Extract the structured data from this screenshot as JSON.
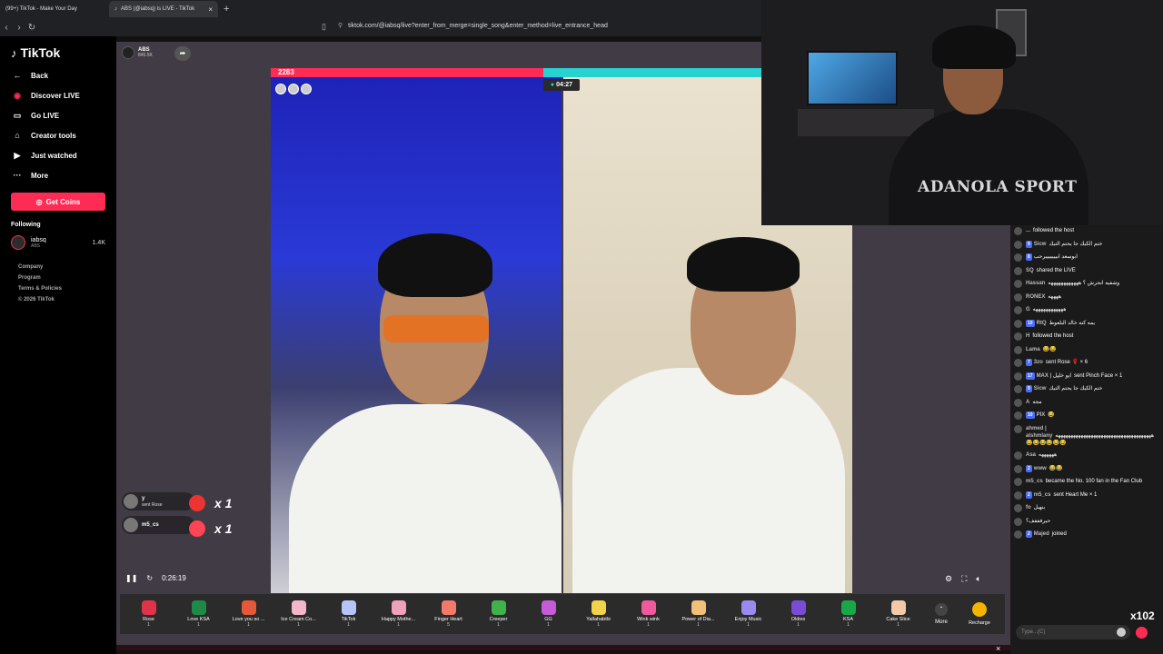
{
  "browser": {
    "tabs": [
      {
        "title": "(99+) TikTok - Make Your Day"
      },
      {
        "title": "ABS (@iabsq) is LIVE - TikTok"
      }
    ],
    "url": "tiktok.com/@iabsq/live?enter_from_merge=single_song&enter_method=live_entrance_head"
  },
  "sidebar": {
    "logo": "TikTok",
    "nav": [
      {
        "label": "Back",
        "icon": "back-arrow-icon"
      },
      {
        "label": "Discover LIVE",
        "icon": "live-icon"
      },
      {
        "label": "Go LIVE",
        "icon": "camera-icon"
      },
      {
        "label": "Creator tools",
        "icon": "home-icon"
      },
      {
        "label": "Just watched",
        "icon": "play-icon"
      },
      {
        "label": "More",
        "icon": "more-icon"
      }
    ],
    "get_coins": "Get Coins",
    "following_label": "Following",
    "following": [
      {
        "name": "iabsq",
        "sub": "ABS",
        "count": "1.4K"
      }
    ],
    "footer": [
      "Company",
      "Program",
      "Terms & Policies",
      "© 2026 TikTok"
    ]
  },
  "stream": {
    "host_name": "ABS",
    "host_likes": "845.5K",
    "pk_score": "2283",
    "timer": "04:27",
    "elapsed": "0:26:19"
  },
  "gift_feed": [
    {
      "name": "y",
      "action": "sent Rose",
      "count": "x 1"
    },
    {
      "name": "m5_cs",
      "action": "",
      "count": "x 1"
    }
  ],
  "gifts": [
    {
      "name": "Rose",
      "price": "1",
      "color": "#e0334a"
    },
    {
      "name": "Love KSA",
      "price": "1",
      "color": "#1f8a47"
    },
    {
      "name": "Love you so ...",
      "price": "1",
      "color": "#e5593a"
    },
    {
      "name": "Ice Cream Co...",
      "price": "1",
      "color": "#f2b7c8"
    },
    {
      "name": "TikTok",
      "price": "1",
      "color": "#b7c4f7"
    },
    {
      "name": "Happy Mothe...",
      "price": "1",
      "color": "#f0a0b8"
    },
    {
      "name": "Finger Heart",
      "price": "5",
      "color": "#f37a6a"
    },
    {
      "name": "Creeper",
      "price": "1",
      "color": "#3fb24a"
    },
    {
      "name": "GG",
      "price": "1",
      "color": "#c55bd6"
    },
    {
      "name": "Yallahabibi",
      "price": "1",
      "color": "#f2d24a"
    },
    {
      "name": "Wink wink",
      "price": "1",
      "color": "#f05a9c"
    },
    {
      "name": "Power of Dia...",
      "price": "1",
      "color": "#f2c078"
    },
    {
      "name": "Enjoy Music",
      "price": "1",
      "color": "#9a8af0"
    },
    {
      "name": "Oldies",
      "price": "1",
      "color": "#7a4cd6"
    },
    {
      "name": "KSA",
      "price": "1",
      "color": "#18a848"
    },
    {
      "name": "Cake Slice",
      "price": "1",
      "color": "#f4c9a8"
    }
  ],
  "more_label": "More",
  "recharge_label": "Recharge",
  "webcam": {
    "hoodie_text": "ADANOLA SPORT"
  },
  "chat": [
    {
      "name": "...",
      "text": "followed the host",
      "badge": ""
    },
    {
      "name": "Sicw",
      "text": "ختم الكيك جا يحتم التيك",
      "badge": "9"
    },
    {
      "name": "",
      "text": "ابوسعد ابيييييييرحب",
      "badge": "8"
    },
    {
      "name": "SQ",
      "text": "shared the LIVE",
      "badge": ""
    },
    {
      "name": "Hassan",
      "text": "وشفيه انحرش ؟ ههههههههههههه",
      "badge": ""
    },
    {
      "name": "RONEX",
      "text": "ههههه",
      "badge": ""
    },
    {
      "name": "G",
      "text": "ههههههههههههه",
      "badge": ""
    },
    {
      "name": "RtQ",
      "text": "يمه كنه خالد البلعوط",
      "badge": "10"
    },
    {
      "name": "H",
      "text": "followed the host",
      "badge": ""
    },
    {
      "name": "Lama",
      "text": "😂😂",
      "badge": ""
    },
    {
      "name": "3zo",
      "text": "sent Rose 🌹 × 6",
      "badge": "7"
    },
    {
      "name": "MAX | ابو خليل",
      "text": "sent Pinch Face × 1",
      "badge": "17"
    },
    {
      "name": "Sicw",
      "text": "ختم الكيك جا يحتم التيك",
      "badge": "9"
    },
    {
      "name": "A",
      "text": "مجه",
      "badge": ""
    },
    {
      "name": "PIX",
      "text": "😂",
      "badge": "10"
    },
    {
      "name": "ahmed | alshmlany",
      "text": "ههههههههههههههههههههههههههههههههههههههه😂😂😂😂😂😂",
      "badge": ""
    },
    {
      "name": "Asa",
      "text": "ههههههه",
      "badge": ""
    },
    {
      "name": "www",
      "text": "😂😂",
      "badge": "2"
    },
    {
      "name": "m5_cs",
      "text": "became the No. 100 fan in the Fan Club",
      "badge": ""
    },
    {
      "name": "m5_cs",
      "text": "sent Heart Me × 1",
      "badge": "2"
    },
    {
      "name": "fo",
      "text": "بنهبل",
      "badge": ""
    },
    {
      "name": "",
      "text": "حيرفففف؟",
      "badge": ""
    },
    {
      "name": "Majed",
      "text": "joined",
      "badge": "2"
    }
  ],
  "chat_input_placeholder": "Type...(C)",
  "like_count": "x102"
}
